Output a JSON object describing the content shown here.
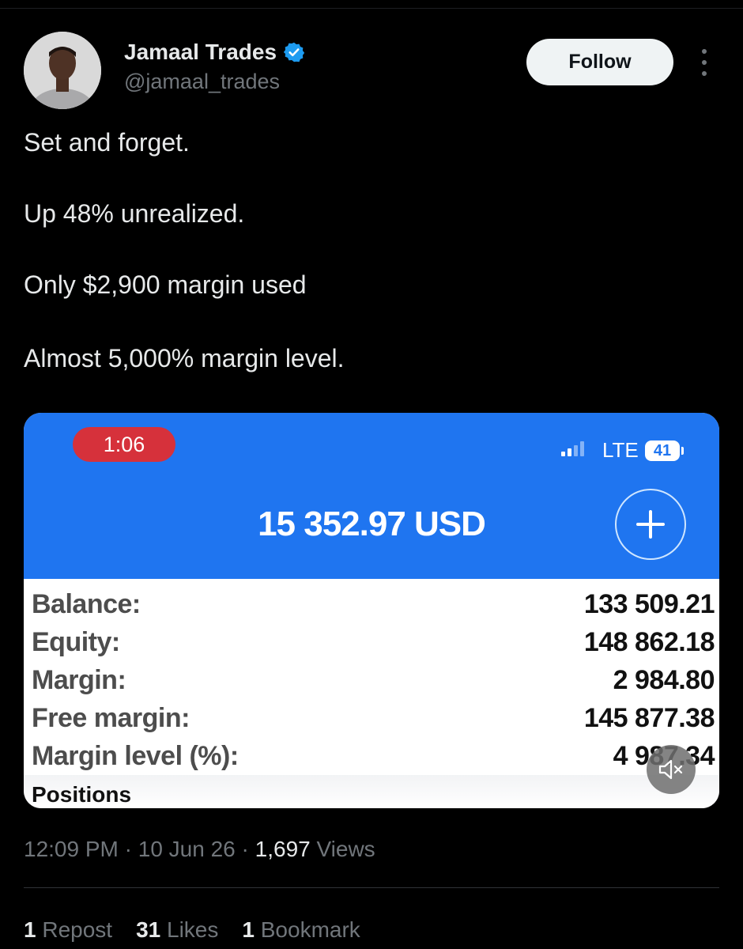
{
  "author": {
    "name": "Jamaal Trades",
    "handle": "@jamaal_trades",
    "verified": true,
    "follow_label": "Follow"
  },
  "tweet": {
    "lines": [
      "Set and forget.",
      "Up 48% unrealized.",
      "Only $2,900 margin used",
      "Almost 5,000% margin level."
    ]
  },
  "media": {
    "status_time": "1:06",
    "network": "LTE",
    "battery": "41",
    "total": "15 352.97 USD",
    "stats": [
      {
        "label": "Balance:",
        "value": "133 509.21"
      },
      {
        "label": "Equity:",
        "value": "148 862.18"
      },
      {
        "label": "Margin:",
        "value": "2 984.80"
      },
      {
        "label": "Free margin:",
        "value": "145 877.38"
      },
      {
        "label": "Margin level (%):",
        "value": "4 987.34"
      }
    ],
    "section_label": "Positions",
    "colors": {
      "header": "#1f75f0",
      "clock_pill": "#d6313b"
    }
  },
  "meta": {
    "time": "12:09 PM",
    "date": "10 Jun 26",
    "views_count": "1,697",
    "views_label": "Views"
  },
  "engagement": {
    "reposts_count": "1",
    "reposts_label": "Repost",
    "likes_count": "31",
    "likes_label": "Likes",
    "bookmarks_count": "1",
    "bookmarks_label": "Bookmark"
  },
  "icons": [
    "verified-badge-icon",
    "more-options-icon",
    "plus-icon",
    "mute-icon",
    "signal-icon",
    "battery-icon"
  ]
}
